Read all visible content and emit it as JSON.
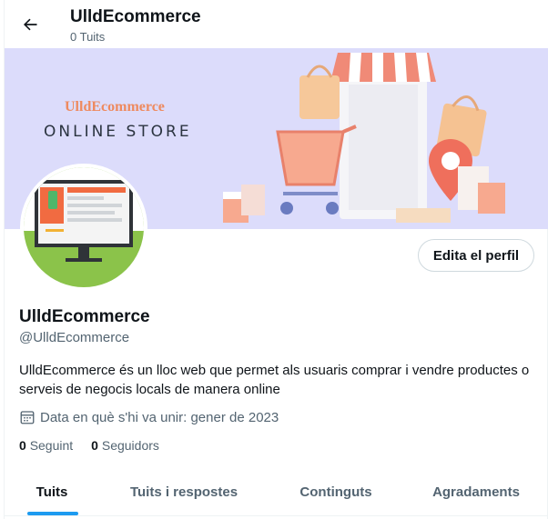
{
  "header": {
    "title": "UlldEcommerce",
    "subtitle": "0 Tuits"
  },
  "banner": {
    "brand": "UlldEcommerce",
    "tagline": "ONLINE STORE"
  },
  "profile": {
    "name": "UlldEcommerce",
    "handle": "@UlldEcommerce",
    "bio": "UlldEcommerce és un lloc web que permet als usuaris comprar i vendre productes o serveis de negocis locals de manera online",
    "joined": "Data en què s'hi va unir: gener de 2023",
    "edit_label": "Edita el perfil"
  },
  "stats": {
    "following_count": "0",
    "following_label": "Seguint",
    "followers_count": "0",
    "followers_label": "Seguidors"
  },
  "tabs": [
    {
      "label": "Tuits",
      "active": true
    },
    {
      "label": "Tuits i respostes",
      "active": false
    },
    {
      "label": "Continguts",
      "active": false
    },
    {
      "label": "Agradaments",
      "active": false
    }
  ],
  "colors": {
    "accent": "#1d9bf0",
    "banner_bg": "#dcdcfb",
    "secondary_text": "#536471"
  },
  "icons": {
    "back": "arrow-left-icon",
    "calendar": "calendar-icon"
  }
}
